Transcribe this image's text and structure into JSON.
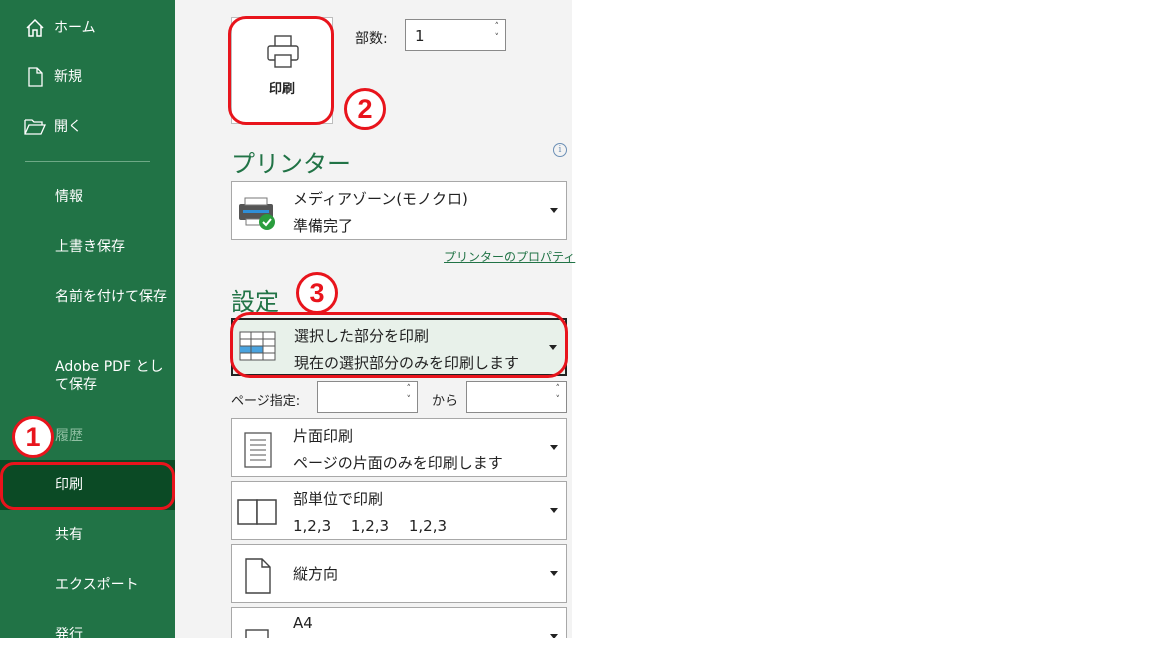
{
  "sidebar": {
    "home": "ホーム",
    "new": "新規",
    "open": "開く",
    "info": "情報",
    "save": "上書き保存",
    "save_as": "名前を付けて保存",
    "save_as_pdf": "Adobe PDF として保存",
    "history": "履歴",
    "print": "印刷",
    "share": "共有",
    "export": "エクスポート",
    "publish": "発行"
  },
  "print_button": {
    "label": "印刷"
  },
  "copies": {
    "label": "部数:",
    "value": "1"
  },
  "printer_section": {
    "title": "プリンター",
    "printer_name": "メディアゾーン(モノクロ)",
    "status": "準備完了",
    "properties_link": "プリンターのプロパティ"
  },
  "settings_section": {
    "title": "設定",
    "print_what": {
      "title": "選択した部分を印刷",
      "subtitle": "現在の選択部分のみを印刷します"
    },
    "pages": {
      "label": "ページ指定:",
      "from_value": "",
      "to_label": "から",
      "to_value": ""
    },
    "sides": {
      "title": "片面印刷",
      "subtitle": "ページの片面のみを印刷します"
    },
    "collation": {
      "title": "部単位で印刷",
      "subtitle": "1,2,3　 1,2,3　 1,2,3"
    },
    "orientation": {
      "title": "縦方向"
    },
    "paper_size": {
      "title": "A4"
    }
  },
  "annotations": [
    "1",
    "2",
    "3"
  ],
  "colors": {
    "excel_green": "#217346",
    "active_green": "#0b4a25",
    "annotation_red": "#e8141c"
  }
}
